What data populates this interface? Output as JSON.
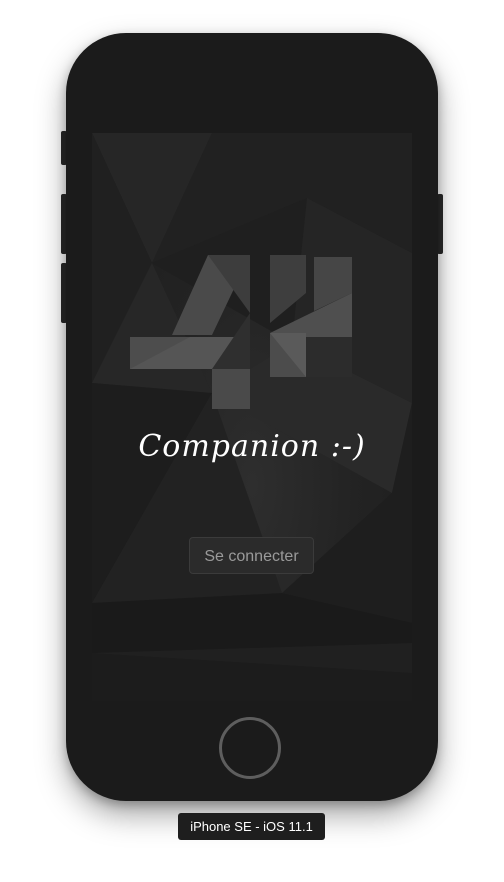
{
  "app": {
    "title": "Companion :-)",
    "connect_button": "Se connecter",
    "logo": "44-logo-icon"
  },
  "simulator": {
    "device_label": "iPhone SE - iOS 11.1"
  },
  "colors": {
    "phone_body": "#1b1b1b",
    "screen_background": "#232323",
    "title_text": "#ffffff",
    "button_text": "#9a9a9a"
  }
}
